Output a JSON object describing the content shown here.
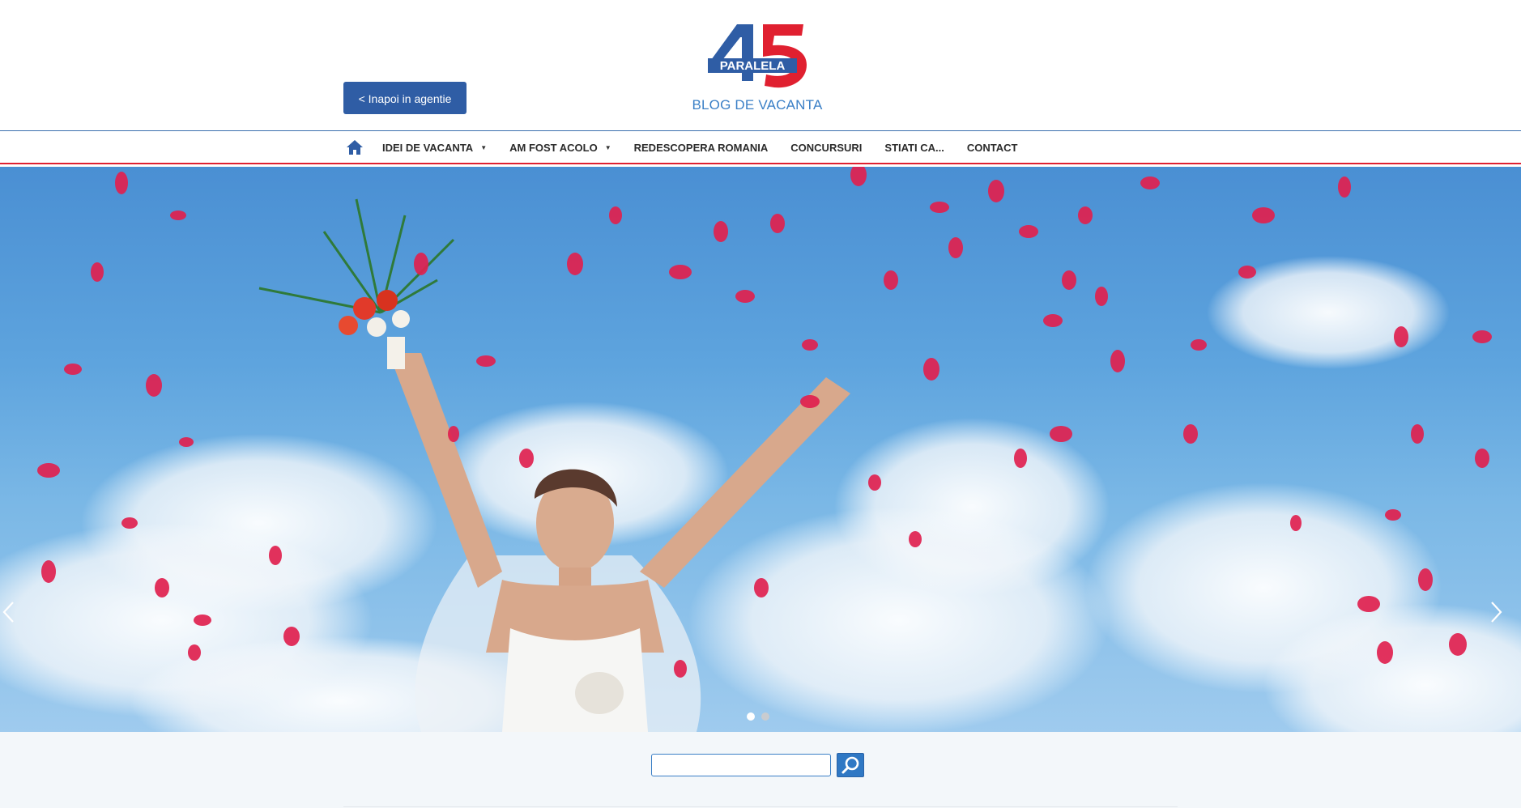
{
  "header": {
    "back_button": "< Inapoi in agentie",
    "logo_number": "45",
    "logo_word": "PARALELA",
    "tagline": "BLOG DE VACANTA"
  },
  "nav": {
    "home_icon": "home-icon",
    "items": [
      {
        "label": "IDEI DE VACANTA",
        "dropdown": true
      },
      {
        "label": "AM FOST ACOLO",
        "dropdown": true
      },
      {
        "label": "REDESCOPERA ROMANIA",
        "dropdown": false
      },
      {
        "label": "CONCURSURI",
        "dropdown": false
      },
      {
        "label": "STIATI CA...",
        "dropdown": false
      },
      {
        "label": "CONTACT",
        "dropdown": false
      }
    ]
  },
  "hero": {
    "slide_count": 2,
    "active_slide": 1,
    "prev_icon": "chevron-left-icon",
    "next_icon": "chevron-right-icon"
  },
  "search": {
    "placeholder": "",
    "button_icon": "search-icon"
  },
  "colors": {
    "brand_blue": "#2f5da5",
    "accent_red": "#e02030",
    "tagline_blue": "#3a7fc6",
    "search_button": "#2f78c4"
  }
}
